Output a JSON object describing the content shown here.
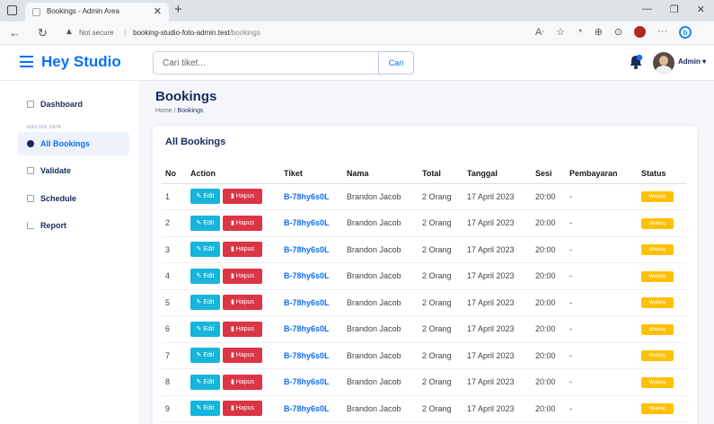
{
  "browser": {
    "tab_title": "Bookings - Admin Area",
    "url_security": "Not secure",
    "url_host": "booking-studio-foto-admin.test",
    "url_path": "/bookings"
  },
  "header": {
    "brand": "Hey Studio",
    "search_placeholder": "Cari tiket...",
    "search_button": "Cari",
    "user_name": "Admin"
  },
  "sidebar": {
    "section_label": "MASTER DATA",
    "items": [
      {
        "label": "Dashboard",
        "icon": "grid-icon"
      },
      {
        "label": "All Bookings",
        "icon": "circle-icon"
      },
      {
        "label": "Validate",
        "icon": "check-square-icon"
      },
      {
        "label": "Schedule",
        "icon": "calendar-icon"
      },
      {
        "label": "Report",
        "icon": "chart-icon"
      }
    ]
  },
  "page": {
    "title": "Bookings",
    "breadcrumb_home": "Home",
    "breadcrumb_sep": "/",
    "breadcrumb_current": "Bookings"
  },
  "card": {
    "title": "All Bookings",
    "columns": [
      "No",
      "Action",
      "Tiket",
      "Nama",
      "Total",
      "Tanggal",
      "Sesi",
      "Pembayaran",
      "Status"
    ],
    "edit_label": "Edit",
    "delete_label": "Hapus",
    "rows": [
      {
        "no": "1",
        "tiket": "B-78hy6s0L",
        "nama": "Brandon Jacob",
        "total": "2 Orang",
        "tanggal": "17 April 2023",
        "sesi": "20:00",
        "pembayaran": "-",
        "status": "Waiting"
      },
      {
        "no": "2",
        "tiket": "B-78hy6s0L",
        "nama": "Brandon Jacob",
        "total": "2 Orang",
        "tanggal": "17 April 2023",
        "sesi": "20:00",
        "pembayaran": "-",
        "status": "Waiting"
      },
      {
        "no": "3",
        "tiket": "B-78hy6s0L",
        "nama": "Brandon Jacob",
        "total": "2 Orang",
        "tanggal": "17 April 2023",
        "sesi": "20:00",
        "pembayaran": "-",
        "status": "Waiting"
      },
      {
        "no": "4",
        "tiket": "B-78hy6s0L",
        "nama": "Brandon Jacob",
        "total": "2 Orang",
        "tanggal": "17 April 2023",
        "sesi": "20:00",
        "pembayaran": "-",
        "status": "Waiting"
      },
      {
        "no": "5",
        "tiket": "B-78hy6s0L",
        "nama": "Brandon Jacob",
        "total": "2 Orang",
        "tanggal": "17 April 2023",
        "sesi": "20:00",
        "pembayaran": "-",
        "status": "Waiting"
      },
      {
        "no": "6",
        "tiket": "B-78hy6s0L",
        "nama": "Brandon Jacob",
        "total": "2 Orang",
        "tanggal": "17 April 2023",
        "sesi": "20:00",
        "pembayaran": "-",
        "status": "Waiting"
      },
      {
        "no": "7",
        "tiket": "B-78hy6s0L",
        "nama": "Brandon Jacob",
        "total": "2 Orang",
        "tanggal": "17 April 2023",
        "sesi": "20:00",
        "pembayaran": "-",
        "status": "Waiting"
      },
      {
        "no": "8",
        "tiket": "B-78hy6s0L",
        "nama": "Brandon Jacob",
        "total": "2 Orang",
        "tanggal": "17 April 2023",
        "sesi": "20:00",
        "pembayaran": "-",
        "status": "Waiting"
      },
      {
        "no": "9",
        "tiket": "B-78hy6s0L",
        "nama": "Brandon Jacob",
        "total": "2 Orang",
        "tanggal": "17 April 2023",
        "sesi": "20:00",
        "pembayaran": "-",
        "status": "Waiting"
      }
    ]
  },
  "colors": {
    "primary": "#0d6efd",
    "edit": "#17b5dc",
    "delete": "#dc3545",
    "waiting": "#ffc107"
  }
}
